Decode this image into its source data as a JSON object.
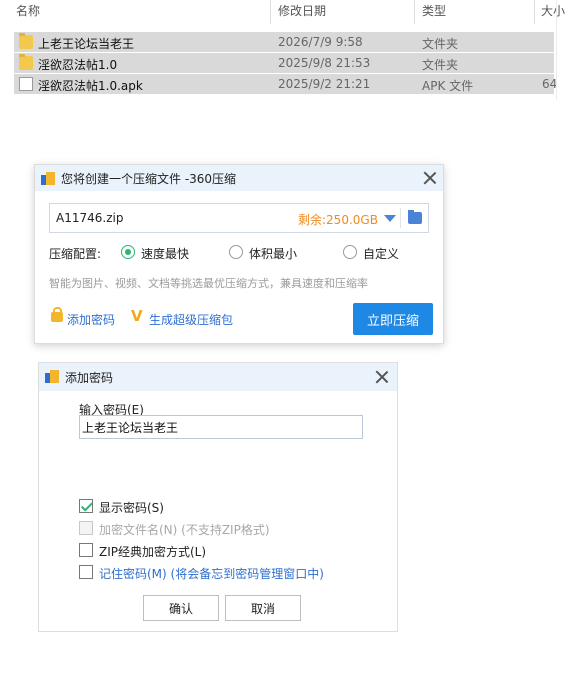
{
  "explorer": {
    "columns": {
      "name": "名称",
      "date": "修改日期",
      "type": "类型",
      "size": "大小"
    },
    "files": [
      {
        "name": "上老王论坛当老王",
        "date": "2026/7/9 9:58",
        "type": "文件夹",
        "size": "",
        "icon": "folder-icon"
      },
      {
        "name": "淫欲忍法帖1.0",
        "date": "2025/9/8 21:53",
        "type": "文件夹",
        "size": "",
        "icon": "folder-icon"
      },
      {
        "name": "淫欲忍法帖1.0.apk",
        "date": "2025/9/2 21:21",
        "type": "APK 文件",
        "size": "64",
        "icon": "file-icon"
      }
    ]
  },
  "zip_dialog": {
    "title": "您将创建一个压缩文件 -360压缩",
    "file_name": "A11746.zip",
    "space_remaining": "剩余:250.0GB",
    "config_label": "压缩配置:",
    "options": [
      "速度最快",
      "体积最小",
      "自定义"
    ],
    "selected_option": "速度最快",
    "description": "智能为图片、视频、文档等挑选最优压缩方式，兼具速度和压缩率",
    "add_password_link": "添加密码",
    "super_package_link": "生成超级压缩包",
    "compress_button": "立即压缩"
  },
  "password_dialog": {
    "title": "添加密码",
    "input_label": "输入密码(E)",
    "password_value": "上老王论坛当老王",
    "options": {
      "show_password": {
        "label": "显示密码(S)",
        "checked": true,
        "enabled": true
      },
      "encrypt_filenames": {
        "label": "加密文件名(N) (不支持ZIP格式)",
        "checked": false,
        "enabled": false
      },
      "zip_classic": {
        "label": "ZIP经典加密方式(L)",
        "checked": false,
        "enabled": true
      },
      "remember_password": {
        "label": "记住密码(M) (将会备忘到密码管理窗口中)",
        "checked": false,
        "enabled": true
      }
    },
    "ok_button": "确认",
    "cancel_button": "取消"
  },
  "colors": {
    "accent_blue": "#1e88e5",
    "link_blue": "#2f6fd1",
    "space_orange": "#f08a1c",
    "check_green": "#2bb673",
    "titlebar_bg": "#eaf2fb"
  }
}
